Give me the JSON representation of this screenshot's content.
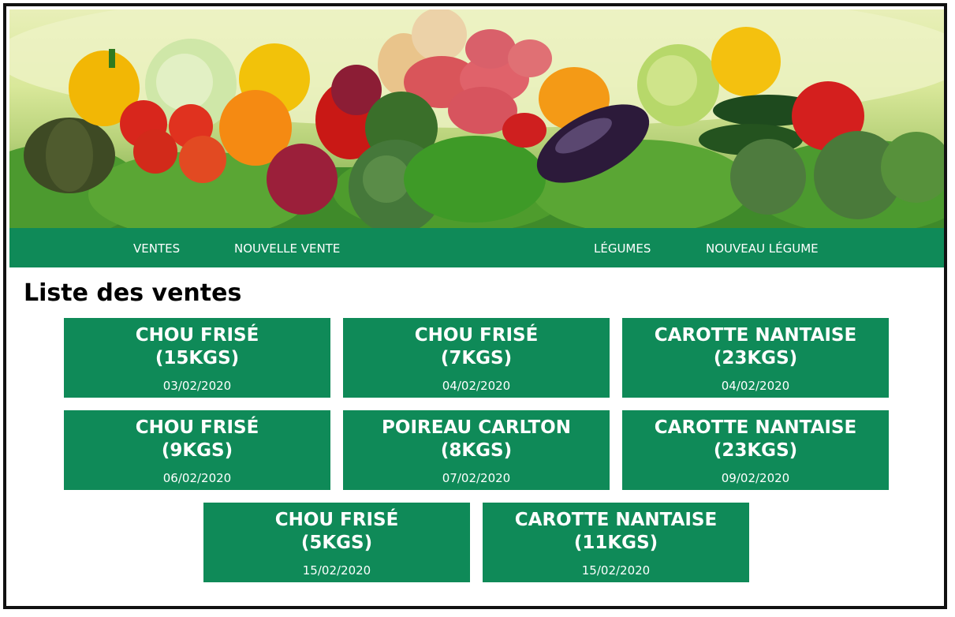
{
  "nav": {
    "ventes": "VENTES",
    "nouvelle_vente": "NOUVELLE VENTE",
    "legumes": "LÉGUMES",
    "nouveau_legume": "NOUVEAU LÉGUME"
  },
  "page": {
    "title": "Liste des ventes"
  },
  "sales": [
    {
      "name": "CHOU FRISÉ",
      "qty": "(15KGS)",
      "date": "03/02/2020"
    },
    {
      "name": "CHOU FRISÉ",
      "qty": "(7KGS)",
      "date": "04/02/2020"
    },
    {
      "name": "CAROTTE NANTAISE",
      "qty": "(23KGS)",
      "date": "04/02/2020"
    },
    {
      "name": "CHOU FRISÉ",
      "qty": "(9KGS)",
      "date": "06/02/2020"
    },
    {
      "name": "POIREAU CARLTON",
      "qty": "(8KGS)",
      "date": "07/02/2020"
    },
    {
      "name": "CAROTTE NANTAISE",
      "qty": "(23KGS)",
      "date": "09/02/2020"
    },
    {
      "name": "CHOU FRISÉ",
      "qty": "(5KGS)",
      "date": "15/02/2020"
    },
    {
      "name": "CAROTTE NANTAISE",
      "qty": "(11KGS)",
      "date": "15/02/2020"
    }
  ],
  "colors": {
    "primary_green": "#0f8a58",
    "text_on_green": "#ffffff",
    "frame_border": "#111111"
  },
  "banner": {
    "image": "vegetables-banner-image"
  }
}
